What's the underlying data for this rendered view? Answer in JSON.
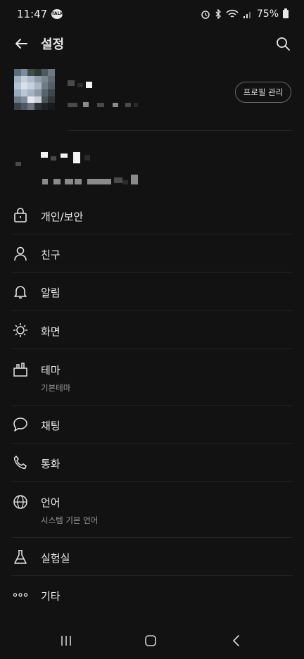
{
  "status_bar": {
    "time": "11:47",
    "talk_badge": "TALK",
    "battery": "75%"
  },
  "header": {
    "title": "설정",
    "back_icon": "arrow-left-icon",
    "search_icon": "search-icon"
  },
  "profile": {
    "manage_button": "프로필 관리"
  },
  "menu": {
    "items": [
      {
        "label": "개인/보안",
        "icon": "lock-icon"
      },
      {
        "label": "친구",
        "icon": "person-icon"
      },
      {
        "label": "알림",
        "icon": "bell-icon"
      },
      {
        "label": "화면",
        "icon": "brightness-icon"
      },
      {
        "label": "테마",
        "sub": "기본테마",
        "icon": "brush-icon"
      },
      {
        "label": "채팅",
        "icon": "chat-bubble-icon"
      },
      {
        "label": "통화",
        "icon": "phone-icon"
      },
      {
        "label": "언어",
        "sub": "시스템 기본 언어",
        "icon": "globe-icon"
      },
      {
        "label": "실험실",
        "icon": "flask-icon"
      },
      {
        "label": "기타",
        "icon": "more-horizontal-icon"
      }
    ]
  },
  "nav": {
    "recent_icon": "recent-apps-icon",
    "home_icon": "home-icon",
    "back_icon": "nav-back-icon"
  }
}
